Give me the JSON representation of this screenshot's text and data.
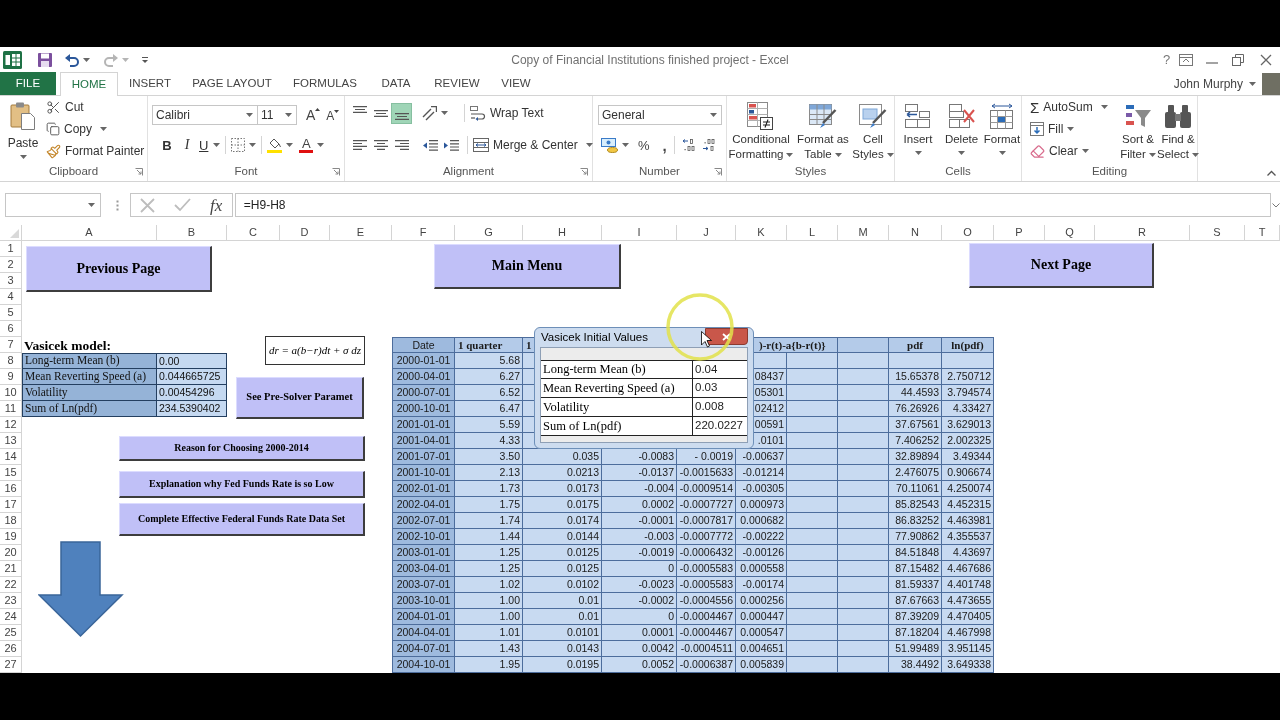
{
  "window": {
    "title": "Copy of Financial Institutions finished project - Excel",
    "help": "?",
    "user": "John Murphy"
  },
  "ribbon_tabs": [
    {
      "label": "FILE",
      "kind": "file",
      "selected": false
    },
    {
      "label": "HOME",
      "kind": "tab",
      "selected": true
    },
    {
      "label": "INSERT",
      "kind": "tab",
      "selected": false
    },
    {
      "label": "PAGE LAYOUT",
      "kind": "tab",
      "selected": false
    },
    {
      "label": "FORMULAS",
      "kind": "tab",
      "selected": false
    },
    {
      "label": "DATA",
      "kind": "tab",
      "selected": false
    },
    {
      "label": "REVIEW",
      "kind": "tab",
      "selected": false
    },
    {
      "label": "VIEW",
      "kind": "tab",
      "selected": false
    }
  ],
  "ribbon": {
    "clipboard": {
      "label": "Clipboard",
      "paste": "Paste",
      "cut": "Cut",
      "copy": "Copy",
      "format_painter": "Format Painter"
    },
    "font": {
      "label": "Font",
      "font_name": "Calibri",
      "font_size": "11",
      "grow": "A",
      "shrink": "A",
      "bold": "B",
      "italic": "I",
      "underline": "U",
      "font_color": "A"
    },
    "alignment": {
      "label": "Alignment",
      "vertical": [
        {
          "selected": false
        },
        {
          "selected": false
        },
        {
          "selected": true
        }
      ],
      "horizontal": [
        {
          "selected": false
        },
        {
          "selected": false
        },
        {
          "selected": false
        }
      ],
      "wrap_text": "Wrap Text",
      "merge": "Merge & Center"
    },
    "number": {
      "label": "Number",
      "format": "General",
      "percent": "%",
      "comma": ","
    },
    "styles": {
      "label": "Styles",
      "buttons": [
        {
          "lines": [
            "Conditional",
            "Formatting"
          ]
        },
        {
          "lines": [
            "Format as",
            "Table"
          ]
        },
        {
          "lines": [
            "Cell",
            "Styles"
          ]
        }
      ]
    },
    "cells": {
      "label": "Cells",
      "buttons": [
        "Insert",
        "Delete",
        "Format"
      ]
    },
    "editing": {
      "label": "Editing",
      "autosum_symbol": "Σ",
      "autosum": "AutoSum",
      "fill": "Fill",
      "clear": "Clear",
      "buttons": [
        {
          "lines": [
            "Sort &",
            "Filter"
          ]
        },
        {
          "lines": [
            "Find &",
            "Select"
          ]
        }
      ]
    }
  },
  "formula_bar": {
    "function_button": "fx",
    "formula": "=H9-H8"
  },
  "sheet": {
    "columns": [
      "A",
      "B",
      "C",
      "D",
      "E",
      "F",
      "G",
      "H",
      "I",
      "J",
      "K",
      "L",
      "M",
      "N",
      "O",
      "P",
      "Q",
      "R",
      "S",
      "T"
    ],
    "rows": [
      "1",
      "2",
      "3",
      "4",
      "5",
      "6",
      "7",
      "8",
      "9",
      "10",
      "11",
      "12",
      "13",
      "14",
      "15",
      "16",
      "17",
      "18",
      "19",
      "20",
      "21",
      "22",
      "23",
      "24",
      "25",
      "26",
      "27"
    ],
    "buttons": [
      {
        "label": "Previous Page"
      },
      {
        "label": "Main Menu"
      },
      {
        "label": "Next Page"
      },
      {
        "label": "See Pre-Solver Paramet"
      },
      {
        "label": "Reason for Choosing 2000-2014"
      },
      {
        "label": "Explanation why Fed Funds Rate is so Low"
      },
      {
        "label": "Complete Effective Federal Funds Rate Data Set"
      }
    ],
    "model": {
      "title": "Vasicek model:",
      "rows": [
        {
          "label": "Long-term Mean (b)",
          "value": "0.00"
        },
        {
          "label": "Mean Reverting Speed (a)",
          "value": "0.044665725"
        },
        {
          "label": "Volatility",
          "value": "0.00454296"
        },
        {
          "label": "Sum of Ln(pdf)",
          "value": "234.5390402"
        }
      ]
    },
    "equation": "dr = a(b−r)dt + σ dz",
    "data_table": {
      "header": {
        "F": "Date",
        "G": "1 quarter",
        "H": "1",
        "K": ")-r(t)-a{b-r(t)}",
        "N": "pdf",
        "O": "ln(pdf)"
      },
      "rows": [
        {
          "F": "2000-01-01",
          "G": "5.68"
        },
        {
          "F": "2000-04-01",
          "G": "6.27",
          "K": "08437",
          "N": "15.65378",
          "O": "2.750712"
        },
        {
          "F": "2000-07-01",
          "G": "6.52",
          "K": "05301",
          "N": "44.4593",
          "O": "3.794574"
        },
        {
          "F": "2000-10-01",
          "G": "6.47",
          "K": "02412",
          "N": "76.26926",
          "O": "4.33427"
        },
        {
          "F": "2001-01-01",
          "G": "5.59",
          "K": "00591",
          "N": "37.67561",
          "O": "3.629013"
        },
        {
          "F": "2001-04-01",
          "G": "4.33",
          "K": ".0101",
          "N": "7.406252",
          "O": "2.002325"
        },
        {
          "F": "2001-07-01",
          "G": "3.50",
          "H": "0.035",
          "I": "-0.0083",
          "J": "- 0.0019",
          "K": "-0.00637",
          "N": "32.89894",
          "O": "3.49344"
        },
        {
          "F": "2001-10-01",
          "G": "2.13",
          "H": "0.0213",
          "I": "-0.0137",
          "J": "-0.0015633",
          "K": "-0.01214",
          "N": "2.476075",
          "O": "0.906674"
        },
        {
          "F": "2002-01-01",
          "G": "1.73",
          "H": "0.0173",
          "I": "-0.004",
          "J": "-0.0009514",
          "K": "-0.00305",
          "N": "70.11061",
          "O": "4.250074"
        },
        {
          "F": "2002-04-01",
          "G": "1.75",
          "H": "0.0175",
          "I": "0.0002",
          "J": "-0.0007727",
          "K": "0.000973",
          "N": "85.82543",
          "O": "4.452315"
        },
        {
          "F": "2002-07-01",
          "G": "1.74",
          "H": "0.0174",
          "I": "-0.0001",
          "J": "-0.0007817",
          "K": "0.000682",
          "N": "86.83252",
          "O": "4.463981"
        },
        {
          "F": "2002-10-01",
          "G": "1.44",
          "H": "0.0144",
          "I": "-0.003",
          "J": "-0.0007772",
          "K": "-0.00222",
          "N": "77.90862",
          "O": "4.355537"
        },
        {
          "F": "2003-01-01",
          "G": "1.25",
          "H": "0.0125",
          "I": "-0.0019",
          "J": "-0.0006432",
          "K": "-0.00126",
          "N": "84.51848",
          "O": "4.43697"
        },
        {
          "F": "2003-04-01",
          "G": "1.25",
          "H": "0.0125",
          "I": "0",
          "J": "-0.0005583",
          "K": "0.000558",
          "N": "87.15482",
          "O": "4.467686"
        },
        {
          "F": "2003-07-01",
          "G": "1.02",
          "H": "0.0102",
          "I": "-0.0023",
          "J": "-0.0005583",
          "K": "-0.00174",
          "N": "81.59337",
          "O": "4.401748"
        },
        {
          "F": "2003-10-01",
          "G": "1.00",
          "H": "0.01",
          "I": "-0.0002",
          "J": "-0.0004556",
          "K": "0.000256",
          "N": "87.67663",
          "O": "4.473655"
        },
        {
          "F": "2004-01-01",
          "G": "1.00",
          "H": "0.01",
          "I": "0",
          "J": "-0.0004467",
          "K": "0.000447",
          "N": "87.39209",
          "O": "4.470405"
        },
        {
          "F": "2004-04-01",
          "G": "1.01",
          "H": "0.0101",
          "I": "0.0001",
          "J": "-0.0004467",
          "K": "0.000547",
          "N": "87.18204",
          "O": "4.467998"
        },
        {
          "F": "2004-07-01",
          "G": "1.43",
          "H": "0.0143",
          "I": "0.0042",
          "J": "-0.0004511",
          "K": "0.004651",
          "N": "51.99489",
          "O": "3.951145"
        },
        {
          "F": "2004-10-01",
          "G": "1.95",
          "H": "0.0195",
          "I": "0.0052",
          "J": "-0.0006387",
          "K": "0.005839",
          "N": "38.4492",
          "O": "3.649338"
        }
      ]
    }
  },
  "dialog": {
    "title": "Vasicek Initial Values",
    "rows": [
      {
        "label": "Long-term Mean (b)",
        "value": "0.04"
      },
      {
        "label": "Mean Reverting Speed (a)",
        "value": "0.03"
      },
      {
        "label": "Volatility",
        "value": "0.008"
      },
      {
        "label": "Sum of Ln(pdf)",
        "value": "220.0227"
      }
    ]
  }
}
